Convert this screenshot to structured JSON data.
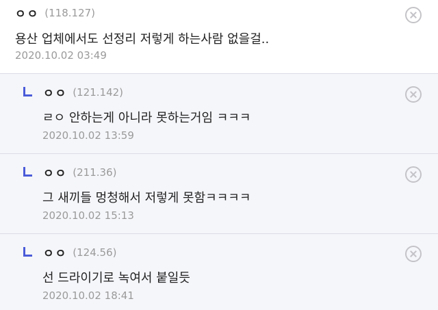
{
  "comments": [
    {
      "nickname": "ㅇㅇ",
      "ip": "(118.127)",
      "text": "용산 업체에서도 선정리 저렇게 하는사람 없을걸..",
      "date": "2020.10.02 03:49"
    },
    {
      "nickname": "ㅇㅇ",
      "ip": "(121.142)",
      "text": "ㄹㅇ 안하는게 아니라 못하는거임 ㅋㅋㅋ",
      "date": "2020.10.02 13:59"
    },
    {
      "nickname": "ㅇㅇ",
      "ip": "(211.36)",
      "text": "그 새끼들 멍청해서 저렇게 못함ㅋㅋㅋㅋ",
      "date": "2020.10.02 15:13"
    },
    {
      "nickname": "ㅇㅇ",
      "ip": "(124.56)",
      "text": "선 드라이기로 녹여서 붙일듯",
      "date": "2020.10.02 18:41"
    }
  ],
  "icons": {
    "delete": "close-circle-icon",
    "reply": "reply-arrow-icon"
  },
  "colors": {
    "reply_background": "#f5f6fa",
    "reply_marker": "#4a5bd8",
    "meta_text": "#9a9a9a",
    "divider": "#dcdce6"
  }
}
